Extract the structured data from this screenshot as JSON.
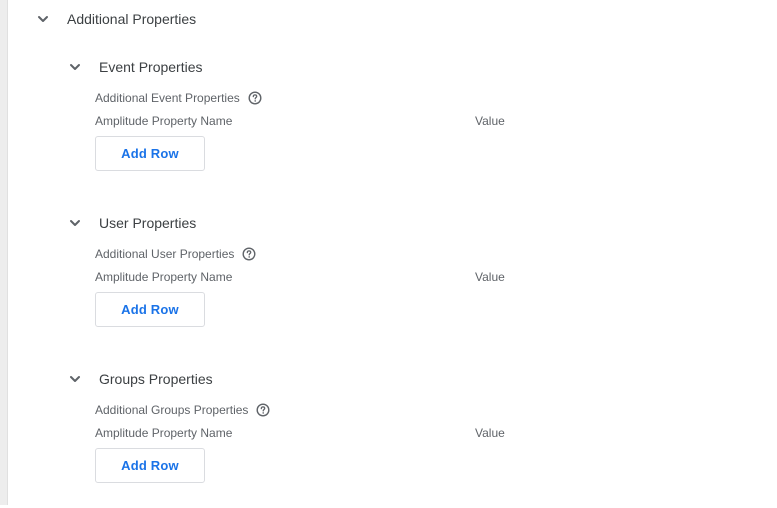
{
  "main": {
    "title": "Additional Properties"
  },
  "sections": [
    {
      "title": "Event Properties",
      "field_label": "Additional Event Properties",
      "columns": [
        "Amplitude Property Name",
        "Value"
      ],
      "add_row_label": "Add Row"
    },
    {
      "title": "User Properties",
      "field_label": "Additional User Properties",
      "columns": [
        "Amplitude Property Name",
        "Value"
      ],
      "add_row_label": "Add Row"
    },
    {
      "title": "Groups Properties",
      "field_label": "Additional Groups Properties",
      "columns": [
        "Amplitude Property Name",
        "Value"
      ],
      "add_row_label": "Add Row"
    }
  ],
  "colors": {
    "accent": "#1a73e8",
    "heading": "#3c4043",
    "secondary_text": "#5f6368",
    "border": "#dadce0"
  },
  "icons": {
    "collapse": "chevron-down-icon",
    "help": "help-circle-icon"
  }
}
